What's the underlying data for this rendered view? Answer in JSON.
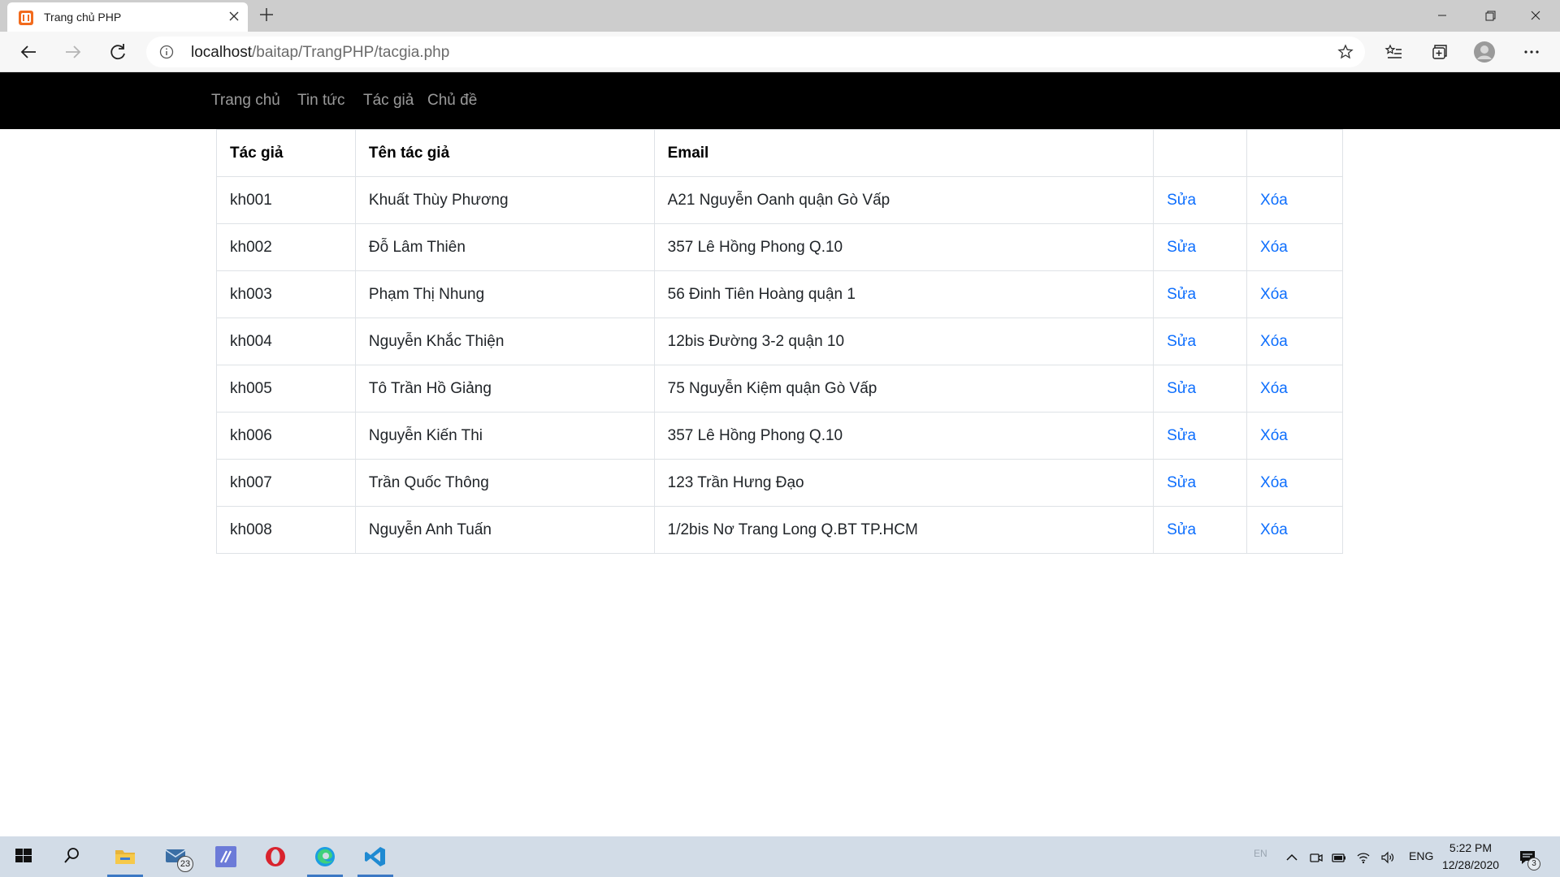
{
  "browser": {
    "tab_title": "Trang chủ PHP",
    "url_host": "localhost",
    "url_path": "/baitap/TrangPHP/tacgia.php"
  },
  "nav": {
    "links": [
      "Trang chủ",
      "Tin tức",
      "Tác giả",
      "Chủ đề"
    ]
  },
  "table": {
    "headers": [
      "Tác giả",
      "Tên tác giả",
      "Email",
      "",
      ""
    ],
    "edit_label": "Sửa",
    "delete_label": "Xóa",
    "rows": [
      {
        "id": "kh001",
        "name": "Khuất Thùy Phương",
        "email": "A21 Nguyễn Oanh quận Gò Vấp"
      },
      {
        "id": "kh002",
        "name": "Đỗ Lâm Thiên",
        "email": "357 Lê Hồng Phong Q.10"
      },
      {
        "id": "kh003",
        "name": "Phạm Thị Nhung",
        "email": "56 Đinh Tiên Hoàng quận 1"
      },
      {
        "id": "kh004",
        "name": "Nguyễn Khắc Thiện",
        "email": "12bis Đường 3-2 quận 10"
      },
      {
        "id": "kh005",
        "name": "Tô Trần Hồ Giảng",
        "email": "75 Nguyễn Kiệm quận Gò Vấp"
      },
      {
        "id": "kh006",
        "name": "Nguyễn Kiến Thi",
        "email": "357 Lê Hồng Phong Q.10"
      },
      {
        "id": "kh007",
        "name": "Trần Quốc Thông",
        "email": "123 Trần Hưng Đạo"
      },
      {
        "id": "kh008",
        "name": "Nguyễn Anh Tuấn",
        "email": "1/2bis Nơ Trang Long Q.BT TP.HCM"
      }
    ]
  },
  "taskbar": {
    "mail_badge": "23",
    "input_indicator": "EN",
    "language": "ENG",
    "time": "5:22 PM",
    "date": "12/28/2020",
    "notifications_badge": "3"
  },
  "colors": {
    "navbar_bg": "#000000",
    "link": "#0d6efd",
    "taskbar_bg": "#d2dce7"
  }
}
